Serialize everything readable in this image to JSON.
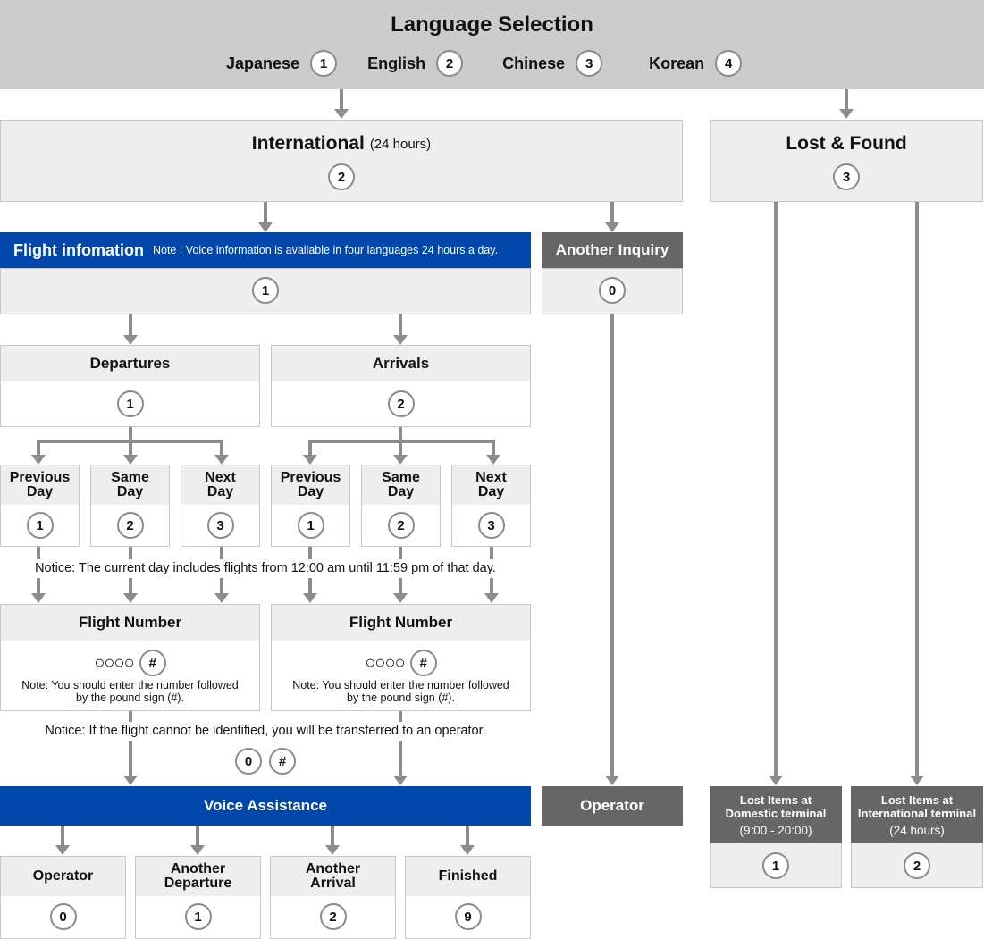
{
  "language_selection": {
    "title": "Language Selection",
    "options": [
      {
        "label": "Japanese",
        "key": "1"
      },
      {
        "label": "English",
        "key": "2"
      },
      {
        "label": "Chinese",
        "key": "3"
      },
      {
        "label": "Korean",
        "key": "4"
      }
    ]
  },
  "international": {
    "title": "International",
    "hours": "(24 hours)",
    "key": "2"
  },
  "lost_found": {
    "title": "Lost & Found",
    "key": "3"
  },
  "flight_info": {
    "title": "Flight infomation",
    "note": "Note : Voice information is available in four languages 24 hours a day.",
    "key": "1"
  },
  "another_inquiry": {
    "title": "Another Inquiry",
    "key": "0"
  },
  "departures": {
    "title": "Departures",
    "key": "1",
    "days": [
      {
        "line1": "Previous",
        "line2": "Day",
        "key": "1"
      },
      {
        "line1": "Same",
        "line2": "Day",
        "key": "2"
      },
      {
        "line1": "Next",
        "line2": "Day",
        "key": "3"
      }
    ]
  },
  "arrivals": {
    "title": "Arrivals",
    "key": "2",
    "days": [
      {
        "line1": "Previous",
        "line2": "Day",
        "key": "1"
      },
      {
        "line1": "Same",
        "line2": "Day",
        "key": "2"
      },
      {
        "line1": "Next",
        "line2": "Day",
        "key": "3"
      }
    ]
  },
  "notice_day": "Notice: The current day includes flights from 12:00 am until 11:59 pm of that day.",
  "flight_number": {
    "title": "Flight Number",
    "digits": "○○○○",
    "key": "#",
    "note_line1": "Note: You should enter the number followed",
    "note_line2": "by the pound sign (#)."
  },
  "notice_operator": "Notice: If the flight cannot be identified, you will be transferred to an operator.",
  "operator_keys": [
    "0",
    "#"
  ],
  "voice_assistance": {
    "title": "Voice Assistance"
  },
  "operator": {
    "title": "Operator"
  },
  "final_options": [
    {
      "line1": "Operator",
      "line2": "",
      "key": "0"
    },
    {
      "line1": "Another",
      "line2": "Departure",
      "key": "1"
    },
    {
      "line1": "Another",
      "line2": "Arrival",
      "key": "2"
    },
    {
      "line1": "Finished",
      "line2": "",
      "key": "9"
    }
  ],
  "lost_items": [
    {
      "line1": "Lost Items at",
      "line2": "Domestic terminal",
      "hours": "(9:00 - 20:00)",
      "key": "1"
    },
    {
      "line1": "Lost Items at",
      "line2": "International terminal",
      "hours": "(24 hours)",
      "key": "2"
    }
  ],
  "colors": {
    "blue": "#0047ab",
    "dark_gray": "#666666",
    "light_gray": "#eeeeee",
    "header_gray": "#cccccc",
    "connector": "#8c8c8c"
  }
}
